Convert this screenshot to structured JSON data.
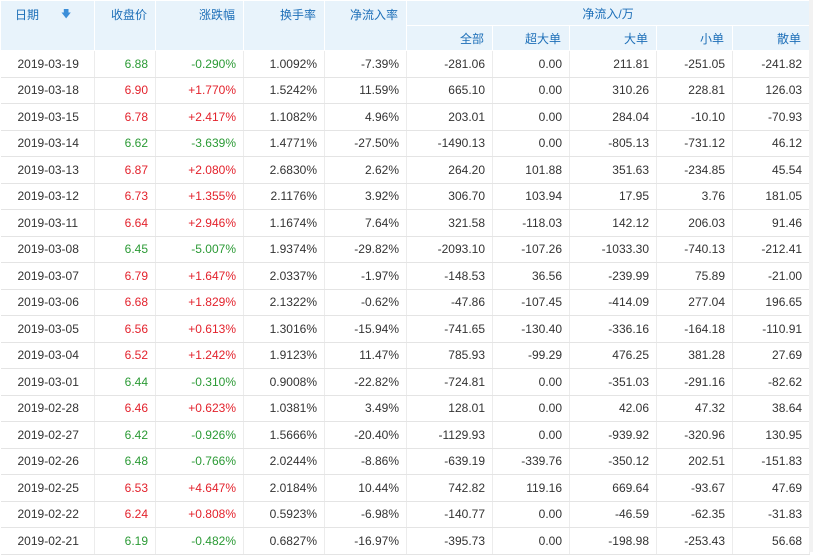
{
  "header": {
    "date": "日期",
    "close": "收盘价",
    "change_pct": "涨跌幅",
    "turnover": "换手率",
    "net_inflow_rate": "净流入率",
    "net_inflow_group": "净流入/万",
    "all": "全部",
    "extra_large": "超大单",
    "large": "大单",
    "medium": "小单",
    "small": "散单",
    "sort_icon": "arrow-down-icon"
  },
  "colors": {
    "up": "#e3222c",
    "down": "#2b9a35",
    "header_bg": "#e8f3fb",
    "header_text": "#1d6fb8"
  },
  "rows": [
    {
      "date": "2019-03-19",
      "close": "6.88",
      "change": "-0.290%",
      "turnover": "1.0092%",
      "nir": "-7.39%",
      "all": "-281.06",
      "xl": "0.00",
      "l": "211.81",
      "m": "-251.05",
      "s": "-241.82",
      "dir": "down"
    },
    {
      "date": "2019-03-18",
      "close": "6.90",
      "change": "+1.770%",
      "turnover": "1.5242%",
      "nir": "11.59%",
      "all": "665.10",
      "xl": "0.00",
      "l": "310.26",
      "m": "228.81",
      "s": "126.03",
      "dir": "up"
    },
    {
      "date": "2019-03-15",
      "close": "6.78",
      "change": "+2.417%",
      "turnover": "1.1082%",
      "nir": "4.96%",
      "all": "203.01",
      "xl": "0.00",
      "l": "284.04",
      "m": "-10.10",
      "s": "-70.93",
      "dir": "up"
    },
    {
      "date": "2019-03-14",
      "close": "6.62",
      "change": "-3.639%",
      "turnover": "1.4771%",
      "nir": "-27.50%",
      "all": "-1490.13",
      "xl": "0.00",
      "l": "-805.13",
      "m": "-731.12",
      "s": "46.12",
      "dir": "down"
    },
    {
      "date": "2019-03-13",
      "close": "6.87",
      "change": "+2.080%",
      "turnover": "2.6830%",
      "nir": "2.62%",
      "all": "264.20",
      "xl": "101.88",
      "l": "351.63",
      "m": "-234.85",
      "s": "45.54",
      "dir": "up"
    },
    {
      "date": "2019-03-12",
      "close": "6.73",
      "change": "+1.355%",
      "turnover": "2.1176%",
      "nir": "3.92%",
      "all": "306.70",
      "xl": "103.94",
      "l": "17.95",
      "m": "3.76",
      "s": "181.05",
      "dir": "up"
    },
    {
      "date": "2019-03-11",
      "close": "6.64",
      "change": "+2.946%",
      "turnover": "1.1674%",
      "nir": "7.64%",
      "all": "321.58",
      "xl": "-118.03",
      "l": "142.12",
      "m": "206.03",
      "s": "91.46",
      "dir": "up"
    },
    {
      "date": "2019-03-08",
      "close": "6.45",
      "change": "-5.007%",
      "turnover": "1.9374%",
      "nir": "-29.82%",
      "all": "-2093.10",
      "xl": "-107.26",
      "l": "-1033.30",
      "m": "-740.13",
      "s": "-212.41",
      "dir": "down"
    },
    {
      "date": "2019-03-07",
      "close": "6.79",
      "change": "+1.647%",
      "turnover": "2.0337%",
      "nir": "-1.97%",
      "all": "-148.53",
      "xl": "36.56",
      "l": "-239.99",
      "m": "75.89",
      "s": "-21.00",
      "dir": "up"
    },
    {
      "date": "2019-03-06",
      "close": "6.68",
      "change": "+1.829%",
      "turnover": "2.1322%",
      "nir": "-0.62%",
      "all": "-47.86",
      "xl": "-107.45",
      "l": "-414.09",
      "m": "277.04",
      "s": "196.65",
      "dir": "up"
    },
    {
      "date": "2019-03-05",
      "close": "6.56",
      "change": "+0.613%",
      "turnover": "1.3016%",
      "nir": "-15.94%",
      "all": "-741.65",
      "xl": "-130.40",
      "l": "-336.16",
      "m": "-164.18",
      "s": "-110.91",
      "dir": "up"
    },
    {
      "date": "2019-03-04",
      "close": "6.52",
      "change": "+1.242%",
      "turnover": "1.9123%",
      "nir": "11.47%",
      "all": "785.93",
      "xl": "-99.29",
      "l": "476.25",
      "m": "381.28",
      "s": "27.69",
      "dir": "up"
    },
    {
      "date": "2019-03-01",
      "close": "6.44",
      "change": "-0.310%",
      "turnover": "0.9008%",
      "nir": "-22.82%",
      "all": "-724.81",
      "xl": "0.00",
      "l": "-351.03",
      "m": "-291.16",
      "s": "-82.62",
      "dir": "down"
    },
    {
      "date": "2019-02-28",
      "close": "6.46",
      "change": "+0.623%",
      "turnover": "1.0381%",
      "nir": "3.49%",
      "all": "128.01",
      "xl": "0.00",
      "l": "42.06",
      "m": "47.32",
      "s": "38.64",
      "dir": "up"
    },
    {
      "date": "2019-02-27",
      "close": "6.42",
      "change": "-0.926%",
      "turnover": "1.5666%",
      "nir": "-20.40%",
      "all": "-1129.93",
      "xl": "0.00",
      "l": "-939.92",
      "m": "-320.96",
      "s": "130.95",
      "dir": "down"
    },
    {
      "date": "2019-02-26",
      "close": "6.48",
      "change": "-0.766%",
      "turnover": "2.0244%",
      "nir": "-8.86%",
      "all": "-639.19",
      "xl": "-339.76",
      "l": "-350.12",
      "m": "202.51",
      "s": "-151.83",
      "dir": "down"
    },
    {
      "date": "2019-02-25",
      "close": "6.53",
      "change": "+4.647%",
      "turnover": "2.0184%",
      "nir": "10.44%",
      "all": "742.82",
      "xl": "119.16",
      "l": "669.64",
      "m": "-93.67",
      "s": "47.69",
      "dir": "up"
    },
    {
      "date": "2019-02-22",
      "close": "6.24",
      "change": "+0.808%",
      "turnover": "0.5923%",
      "nir": "-6.98%",
      "all": "-140.77",
      "xl": "0.00",
      "l": "-46.59",
      "m": "-62.35",
      "s": "-31.83",
      "dir": "up"
    },
    {
      "date": "2019-02-21",
      "close": "6.19",
      "change": "-0.482%",
      "turnover": "0.6827%",
      "nir": "-16.97%",
      "all": "-395.73",
      "xl": "0.00",
      "l": "-198.98",
      "m": "-253.43",
      "s": "56.68",
      "dir": "down"
    }
  ]
}
